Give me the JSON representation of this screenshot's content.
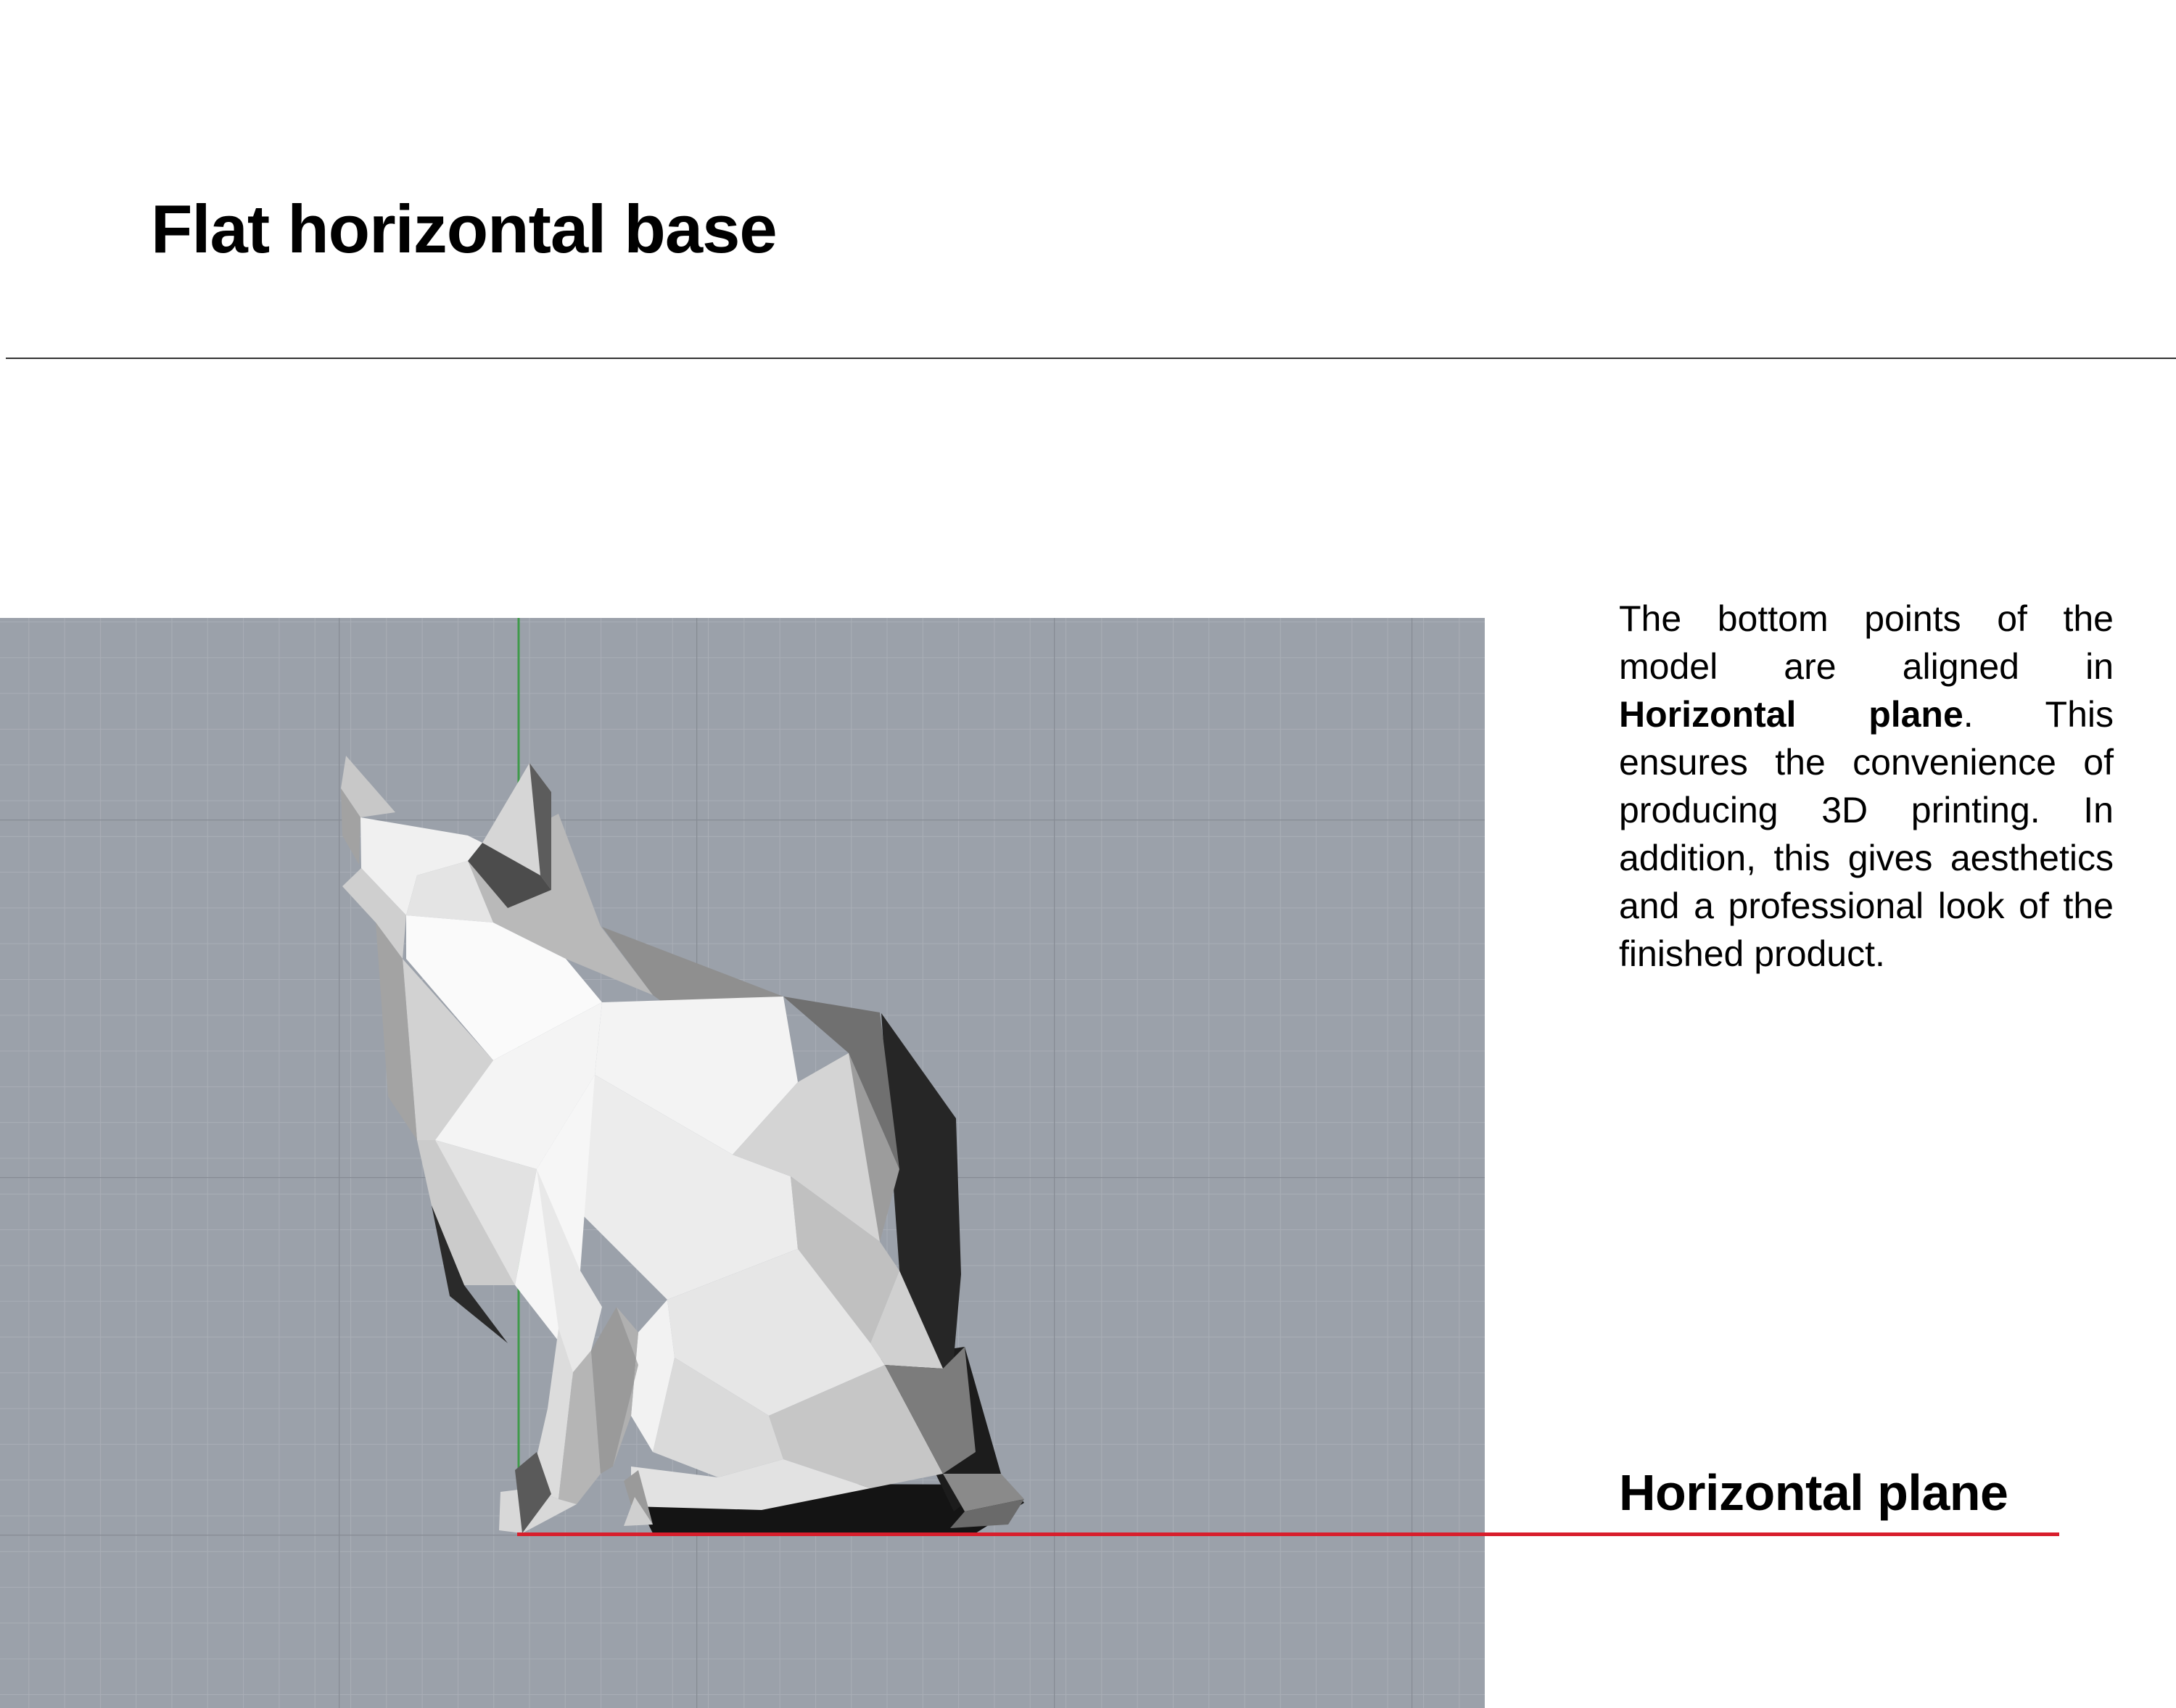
{
  "header": {
    "title": "Flat horizontal base"
  },
  "description": {
    "part1": "The bottom points of the model are aligned in ",
    "bold_term": "Horizontal plane",
    "part2": ". This ensures the convenience of producing 3D printing. In addition, this gives aesthetics and a professional look of the finished product."
  },
  "annotation": {
    "plane_label": "Horizontal plane"
  },
  "colors": {
    "viewport_background": "#9ba1aa",
    "grid_minor": "#a8adb5",
    "grid_major": "#8b9099",
    "vertical_axis": "#3f9a4a",
    "plane_line": "#d81e2c",
    "title_rule": "#333333"
  },
  "viewport": {
    "model": "low-poly cat",
    "view": "side"
  }
}
